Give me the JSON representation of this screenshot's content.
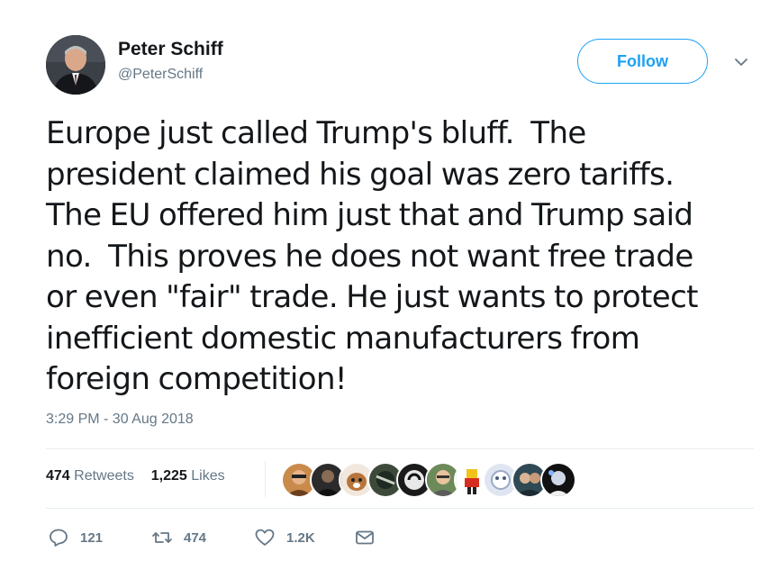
{
  "user": {
    "name": "Peter Schiff",
    "handle": "@PeterSchiff"
  },
  "follow_label": "Follow",
  "tweet": {
    "lines": [
      "Europe just called Trump's bluff.  The",
      "president claimed his goal was zero tariffs.",
      "The EU offered him just that and Trump said",
      "no.  This proves he does not want free trade",
      "or even \"fair\" trade. He just wants to protect",
      "inefficient domestic manufacturers from",
      "foreign competition!"
    ],
    "timestamp": "3:29 PM - 30 Aug 2018"
  },
  "stats": {
    "retweets_count": "474",
    "retweets_label": "Retweets",
    "likes_count": "1,225",
    "likes_label": "Likes"
  },
  "actions": {
    "reply_count": "121",
    "retweet_count": "474",
    "like_count": "1.2K"
  },
  "colors": {
    "accent": "#1da1f2",
    "secondary_text": "#657786",
    "divider": "#e6ecf0"
  },
  "icons": [
    "chevron-down-icon",
    "reply-icon",
    "retweet-icon",
    "heart-icon",
    "envelope-icon"
  ]
}
